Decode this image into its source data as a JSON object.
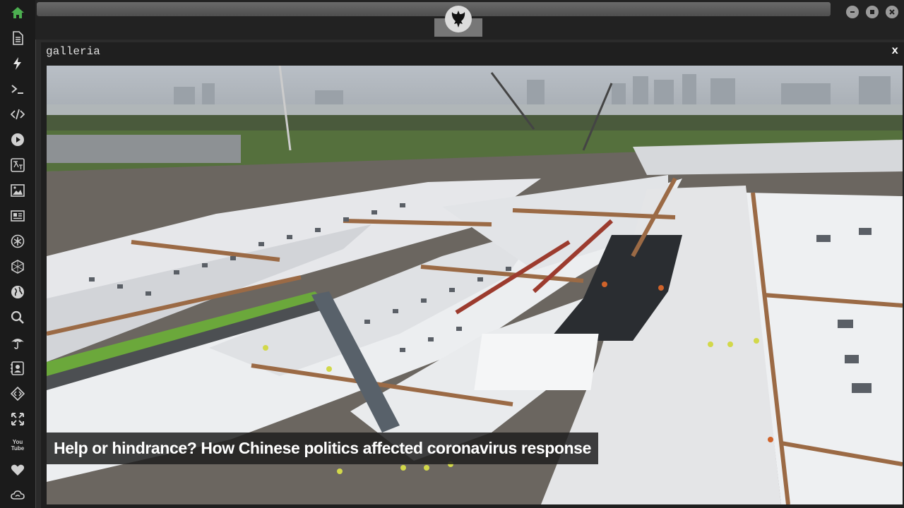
{
  "sidebar": {
    "items": [
      {
        "icon": "home-icon",
        "active": true
      },
      {
        "icon": "document-icon"
      },
      {
        "icon": "lightning-icon"
      },
      {
        "icon": "terminal-icon"
      },
      {
        "icon": "code-icon"
      },
      {
        "icon": "play-icon"
      },
      {
        "icon": "translate-icon"
      },
      {
        "icon": "image-icon"
      },
      {
        "icon": "newspaper-icon"
      },
      {
        "icon": "asterisk-icon"
      },
      {
        "icon": "hexagon-icon"
      },
      {
        "icon": "globe-icon"
      },
      {
        "icon": "search-icon"
      },
      {
        "icon": "umbrella-icon"
      },
      {
        "icon": "contact-card-icon"
      },
      {
        "icon": "diamond-code-icon"
      },
      {
        "icon": "expand-icon"
      },
      {
        "icon": "youtube-icon"
      },
      {
        "icon": "heart-icon"
      },
      {
        "icon": "cloud-icon"
      }
    ],
    "accent_color": "#4caf50"
  },
  "window": {
    "logo": "rebel-alliance-icon"
  },
  "panel": {
    "title": "galleria",
    "close_label": "x"
  },
  "gallery": {
    "caption": "Help or hindrance? How Chinese politics affected coronavirus response"
  }
}
